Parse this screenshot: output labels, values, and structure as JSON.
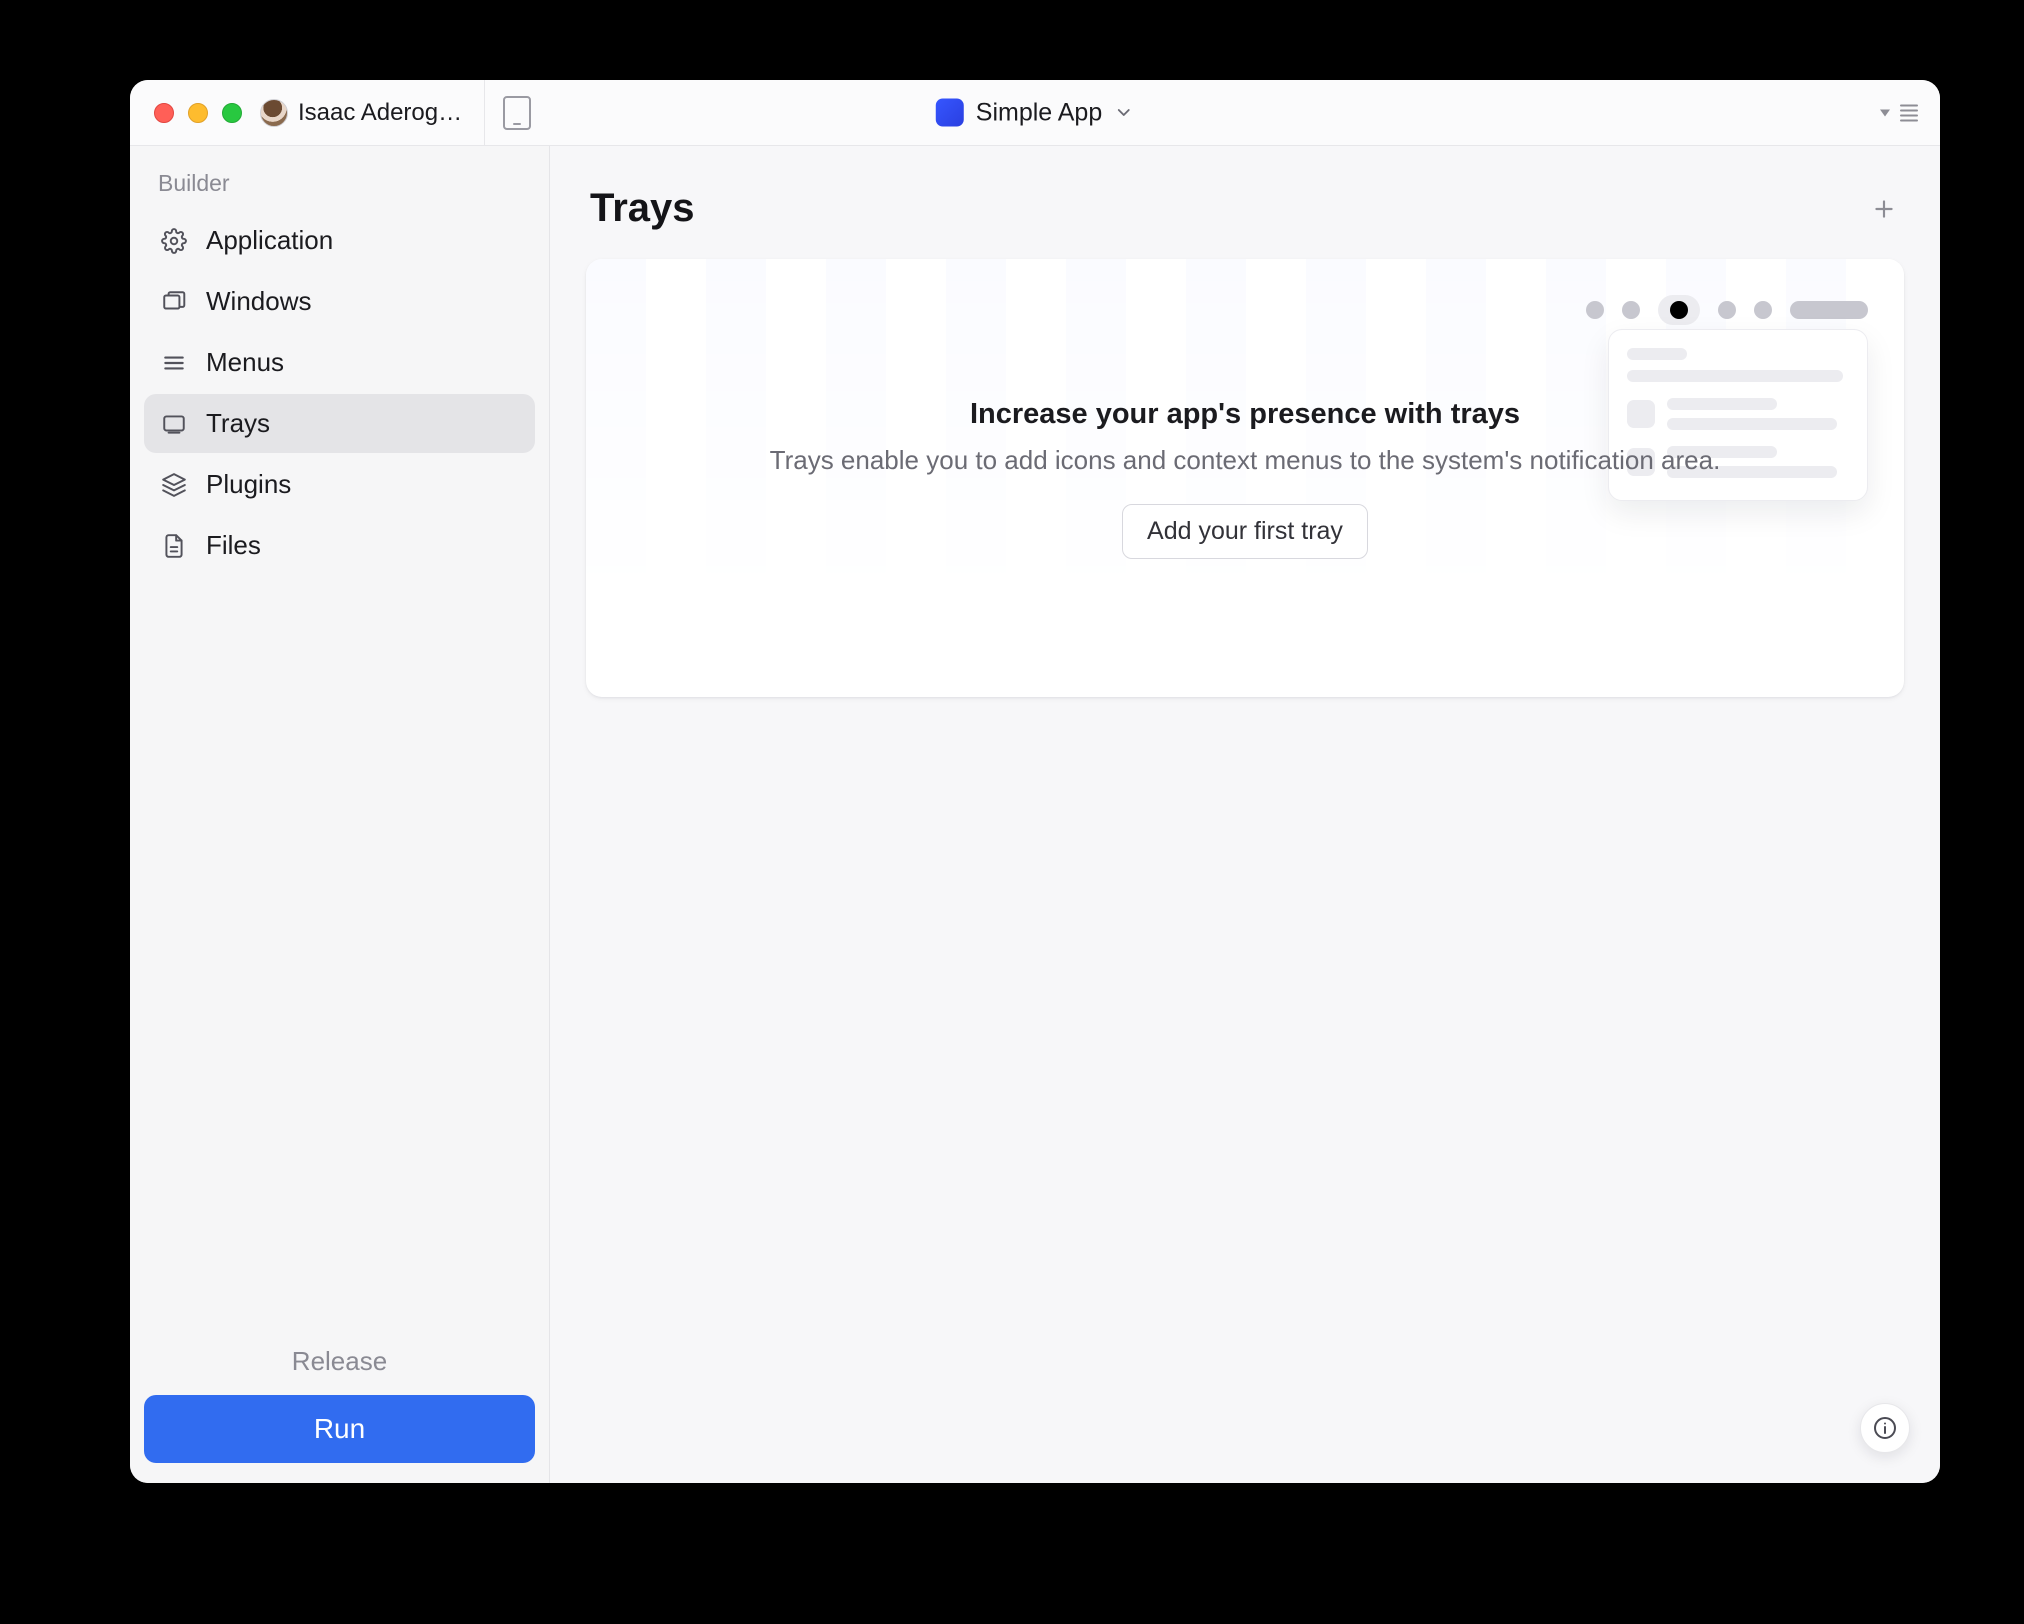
{
  "titlebar": {
    "user_name": "Isaac Aderog…",
    "app_name": "Simple App"
  },
  "sidebar": {
    "section_label": "Builder",
    "items": [
      {
        "label": "Application"
      },
      {
        "label": "Windows"
      },
      {
        "label": "Menus"
      },
      {
        "label": "Trays"
      },
      {
        "label": "Plugins"
      },
      {
        "label": "Files"
      }
    ],
    "release_label": "Release",
    "run_label": "Run"
  },
  "main": {
    "title": "Trays",
    "card_title": "Increase your app's presence with trays",
    "card_subtitle": "Trays enable you to add icons and context menus to the system's notification area.",
    "card_button": "Add your first tray"
  }
}
